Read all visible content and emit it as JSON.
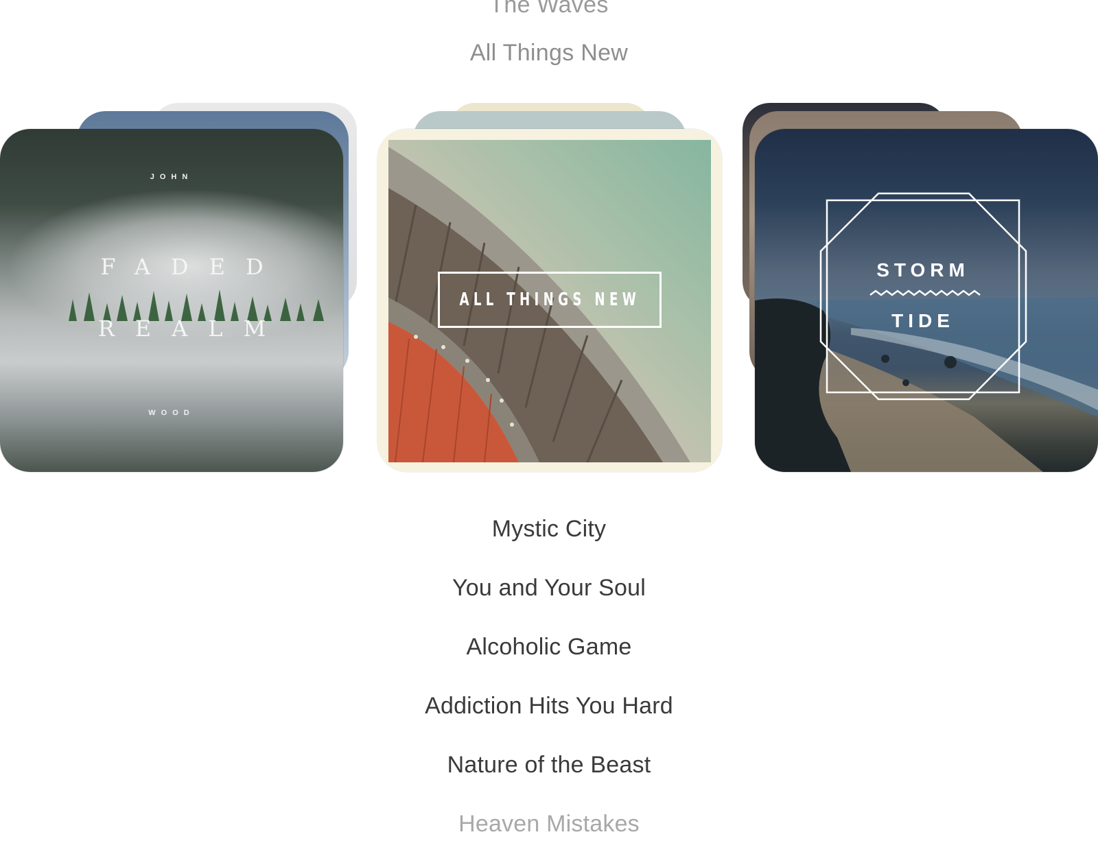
{
  "tracks_above": [
    "The Waves",
    "All Things New"
  ],
  "albums": {
    "left": {
      "artist_first": "JOHN",
      "title_line1": "FADED",
      "title_line2": "REALM",
      "artist_last": "WOOD"
    },
    "center": {
      "title": "ALL THINGS NEW"
    },
    "right": {
      "title_line1": "STORM",
      "title_line2": "TIDE"
    }
  },
  "tracks_below": [
    "Mystic City",
    "You and Your Soul",
    "Alcoholic Game",
    "Addiction Hits You Hard",
    "Nature of the Beast",
    "Heaven Mistakes"
  ],
  "colors": {
    "text_primary": "#3a3a3a",
    "text_muted": "#8e8e8e"
  }
}
